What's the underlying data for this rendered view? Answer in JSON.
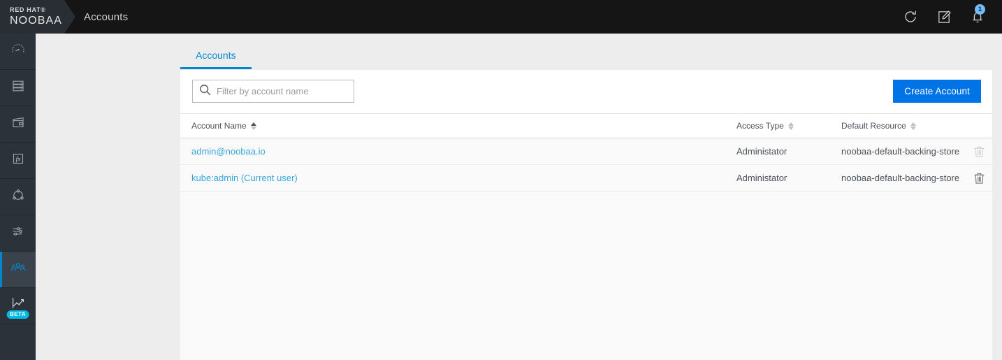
{
  "topbar": {
    "brand_vendor": "RED HAT®",
    "brand_name": "NOOBAA",
    "breadcrumb": "Accounts",
    "actions": [
      {
        "name": "refresh-icon",
        "label": "Refresh"
      },
      {
        "name": "edit-icon",
        "label": "Edit"
      },
      {
        "name": "notifications-bell-icon",
        "label": "Notifications",
        "badge": "1"
      }
    ]
  },
  "sidebar": {
    "items": [
      {
        "icon": "gauge-icon",
        "label": "Overview",
        "active": false,
        "beta": false
      },
      {
        "icon": "servers-icon",
        "label": "Resources",
        "active": false,
        "beta": false
      },
      {
        "icon": "buckets-icon",
        "label": "Buckets",
        "active": false,
        "beta": false
      },
      {
        "icon": "function-fx-icon",
        "label": "Functions",
        "active": false,
        "beta": false
      },
      {
        "icon": "namespace-icon",
        "label": "Namespace",
        "active": false,
        "beta": false
      },
      {
        "icon": "sliders-icon",
        "label": "Settings",
        "active": false,
        "beta": false
      },
      {
        "icon": "users-icon",
        "label": "Accounts",
        "active": true,
        "beta": false
      },
      {
        "icon": "analytics-chart-icon",
        "label": "Analytics",
        "active": false,
        "beta": true,
        "beta_label": "BETA"
      }
    ]
  },
  "main": {
    "tabs": [
      {
        "label": "Accounts",
        "active": true
      }
    ],
    "toolbar": {
      "search_placeholder": "Filter by account name",
      "search_value": "",
      "create_label": "Create Account"
    },
    "table": {
      "columns": [
        {
          "label": "Account Name",
          "sort": "asc"
        },
        {
          "label": "Access Type",
          "sort": "none"
        },
        {
          "label": "Default Resource",
          "sort": "none"
        },
        {
          "label": "",
          "sort": null
        }
      ],
      "rows": [
        {
          "account_name": "admin@noobaa.io",
          "access_type": "Administator",
          "default_resource": "noobaa-default-backing-store",
          "delete_enabled": false
        },
        {
          "account_name": "kube:admin (Current user)",
          "access_type": "Administator",
          "default_resource": "noobaa-default-backing-store",
          "delete_enabled": true
        }
      ]
    }
  },
  "colors": {
    "accent": "#0088ce",
    "button": "#0073e6",
    "link": "#39a5dc",
    "topbar_bg": "#151515",
    "brand_bg": "#292e34",
    "sidebar_bg": "#2b323a",
    "beta_badge": "#00b9e4",
    "notif_badge": "#73bcf7"
  }
}
